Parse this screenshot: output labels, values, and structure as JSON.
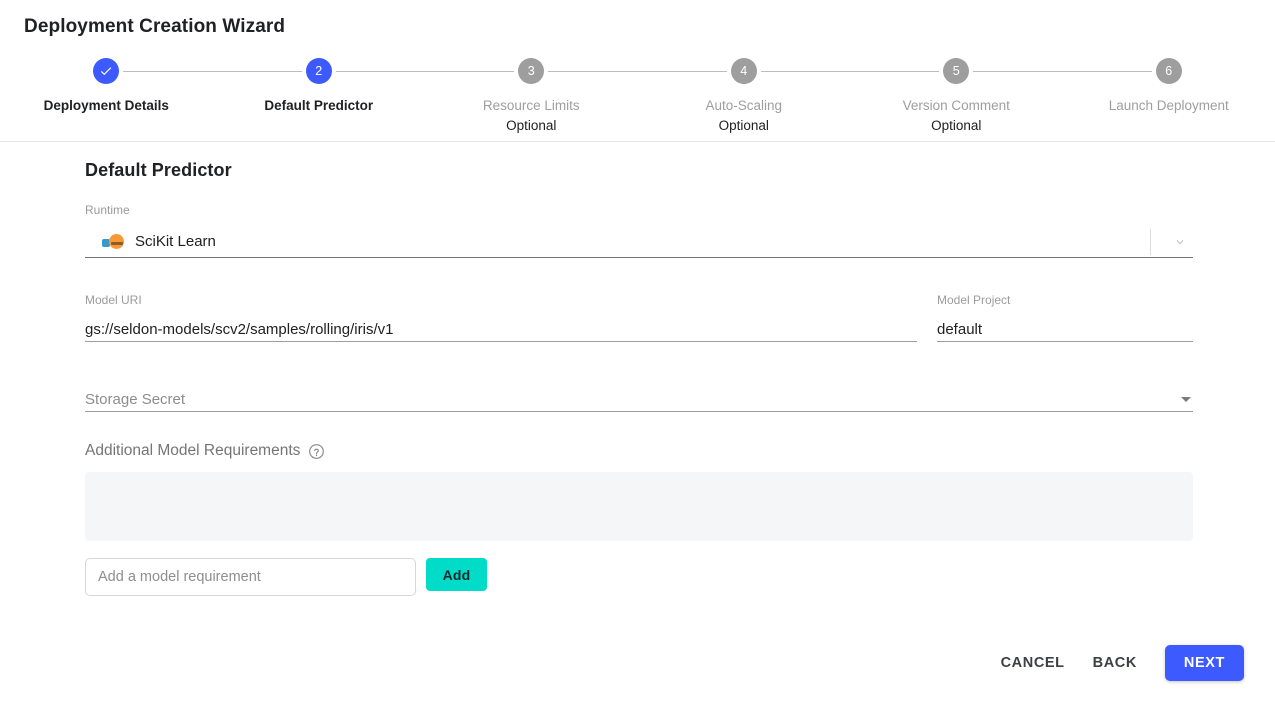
{
  "header": {
    "title": "Deployment Creation Wizard"
  },
  "stepper": {
    "steps": [
      {
        "number": "",
        "label": "Deployment Details",
        "optional": "",
        "state": "done",
        "icon": "check-icon"
      },
      {
        "number": "2",
        "label": "Default Predictor",
        "optional": "",
        "state": "active"
      },
      {
        "number": "3",
        "label": "Resource Limits",
        "optional": "Optional",
        "state": "upcoming"
      },
      {
        "number": "4",
        "label": "Auto-Scaling",
        "optional": "Optional",
        "state": "upcoming"
      },
      {
        "number": "5",
        "label": "Version Comment",
        "optional": "Optional",
        "state": "upcoming"
      },
      {
        "number": "6",
        "label": "Launch Deployment",
        "optional": "",
        "state": "upcoming"
      }
    ]
  },
  "main": {
    "section_title": "Default Predictor",
    "runtime": {
      "label": "Runtime",
      "value": "SciKit Learn",
      "icon": "scikit-learn-logo",
      "dropdown_icon": "chevron-down-icon"
    },
    "model_uri": {
      "label": "Model URI",
      "value": "gs://seldon-models/scv2/samples/rolling/iris/v1"
    },
    "model_project": {
      "label": "Model Project",
      "value": "default"
    },
    "storage_secret": {
      "placeholder": "Storage Secret",
      "value": "",
      "dropdown_icon": "triangle-down-icon"
    },
    "additional_requirements": {
      "label": "Additional Model Requirements",
      "help_icon": "help-circle-icon",
      "items": [],
      "input_placeholder": "Add a model requirement",
      "input_value": "",
      "add_label": "Add"
    }
  },
  "footer": {
    "cancel_label": "CANCEL",
    "back_label": "BACK",
    "next_label": "NEXT"
  },
  "colors": {
    "accent_blue": "#3d5afe",
    "accent_teal": "#00dcc8",
    "step_inactive": "#9e9e9e",
    "requirements_box": "#f5f6f7"
  }
}
